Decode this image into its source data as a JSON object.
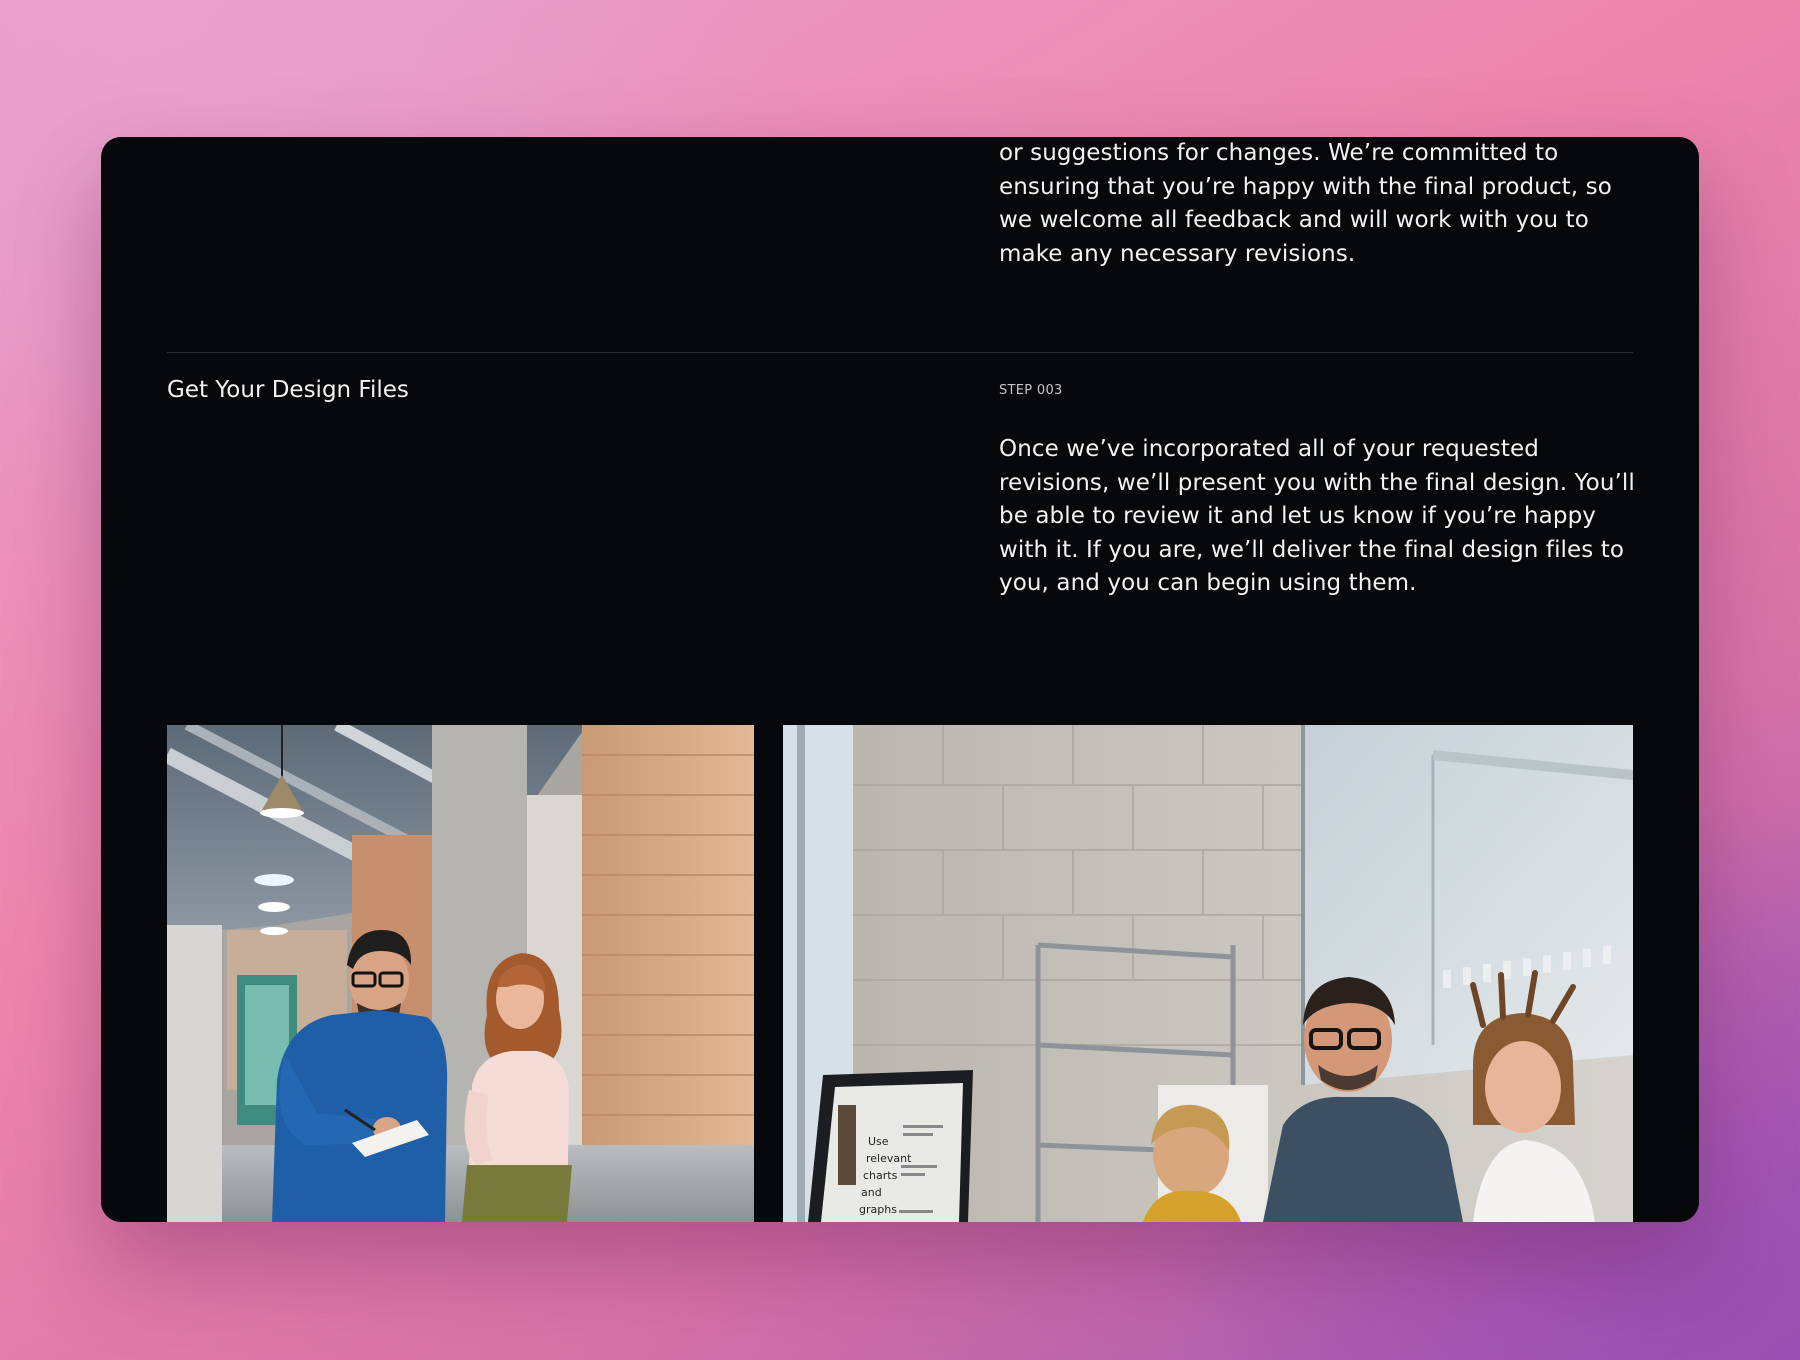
{
  "previous_step": {
    "text_tail": "or suggestions for changes. We’re committed to ensuring that you’re happy with the final product, so we welcome all feedback and will work with you to make any necessary revisions."
  },
  "step": {
    "title": "Get Your Design Files",
    "number": "STEP 003",
    "description": "Once we’ve incorporated all of your requested revisions, we’ll present you with the final design. You’ll be able to review it and let us know if you’re happy with it. If you are, we’ll deliver the final design files to you, and you can begin using them."
  },
  "photos": {
    "left": {
      "subject": "two-people-reviewing-notes-in-office-hallway"
    },
    "right": {
      "subject": "team-looking-at-laptop-in-office",
      "screen_text": [
        "Use",
        "relevant",
        "charts",
        "and",
        "graphs"
      ]
    }
  },
  "colors": {
    "panel_background": "#06080b",
    "text_primary": "#f2f2f2",
    "text_muted": "#c4c6c9",
    "divider": "#2a2d31",
    "backdrop_pink": "#ee86ab",
    "backdrop_purple": "#9a55b4"
  }
}
